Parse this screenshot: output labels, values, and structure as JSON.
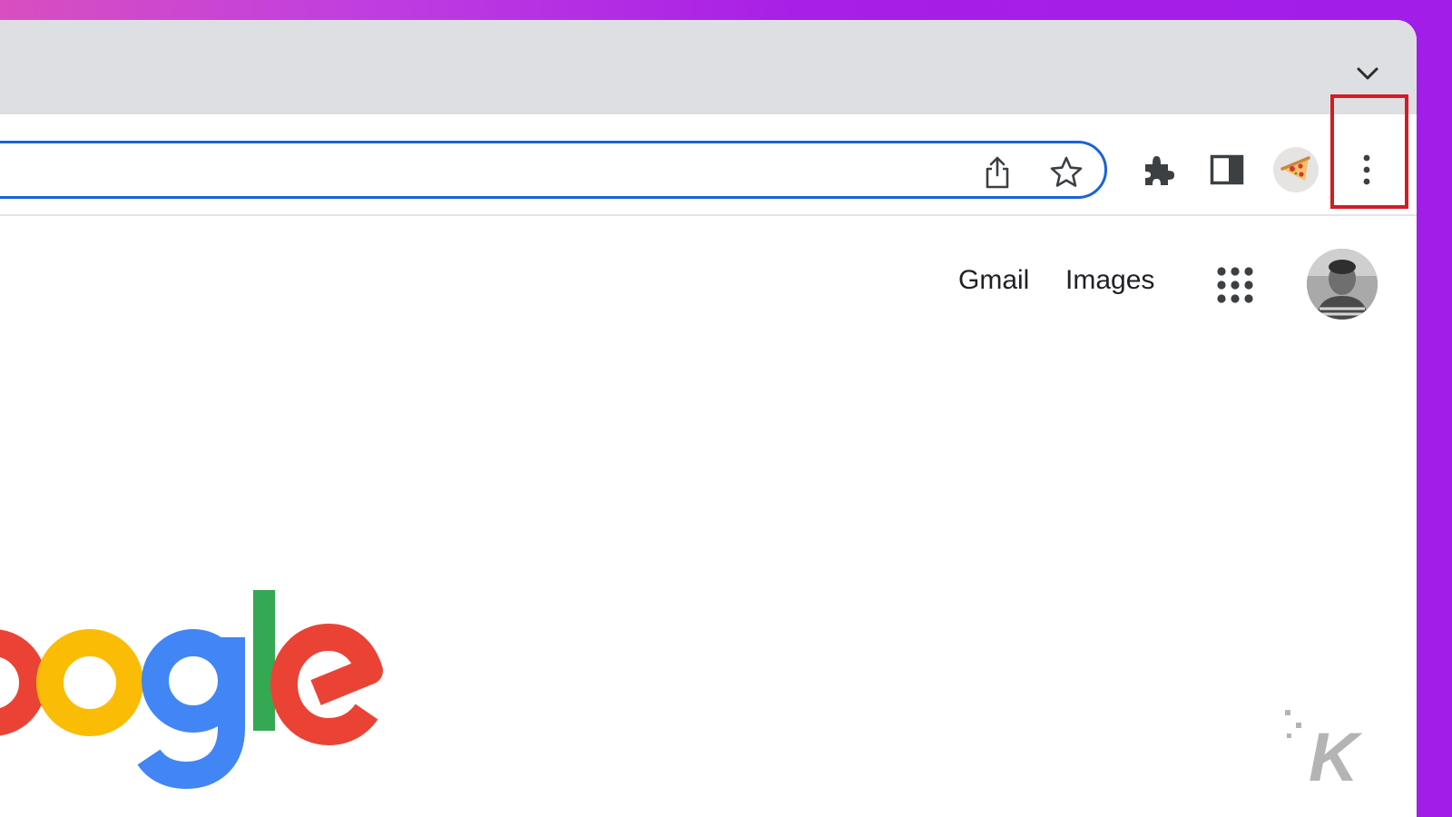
{
  "browser": {
    "tabstrip": {
      "tab_search_icon": "chevron-down-icon"
    },
    "toolbar": {
      "omnibox_icons": [
        "share-icon",
        "star-icon"
      ],
      "buttons": [
        "extensions-puzzle-icon",
        "side-panel-icon",
        "profile-avatar",
        "more-vert-icon"
      ],
      "highlight_color": "#d31c24",
      "omnibox_border_color": "#1a63d6"
    }
  },
  "page": {
    "links": {
      "gmail": "Gmail",
      "images": "Images"
    },
    "apps_icon": "apps-grid-icon",
    "logo_visible_text": "ogle",
    "logo_colors": {
      "red": "#ea4335",
      "yellow": "#fbbc05",
      "blue": "#4285f4",
      "green": "#34a853"
    }
  },
  "watermark": {
    "text": "K"
  }
}
